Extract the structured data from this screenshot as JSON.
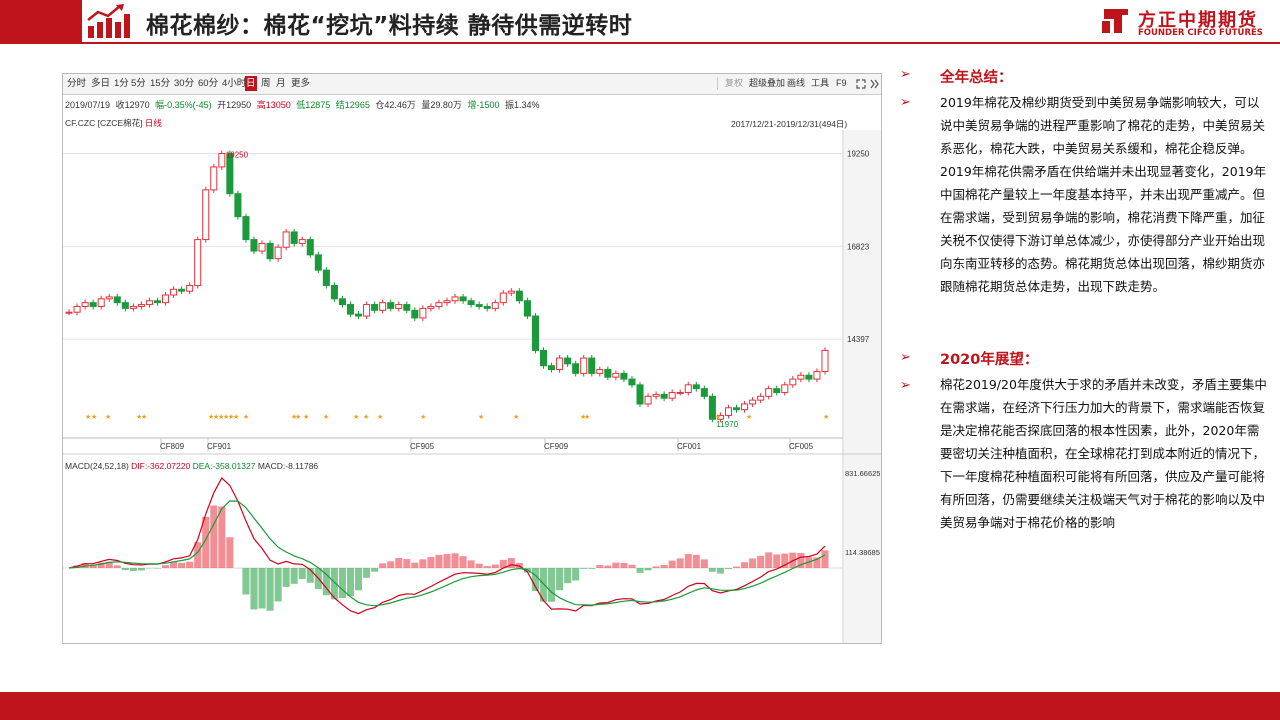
{
  "header": {
    "title": "棉花棉纱：棉花“挖坑”料持续   静待供需逆转时",
    "logo_cn": "方正中期期货",
    "logo_en": "FOUNDER CIFCO FUTURES"
  },
  "toolbar": {
    "periods": [
      "分时",
      "多日",
      "1分",
      "5分",
      "15分",
      "30分",
      "60分",
      "4小时",
      "日",
      "周",
      "月",
      "更多"
    ],
    "active_period": "日",
    "tools": [
      "复权",
      "超级叠加",
      "画线",
      "工具",
      "F9"
    ]
  },
  "quote": {
    "date": "2019/07/19",
    "close": "收12970",
    "change": "幅-0.35%(-45)",
    "open": "开12950",
    "high": "高13050",
    "low": "低12875",
    "settle": "结12965",
    "position": "仓42.46万",
    "volume": "量29.80万",
    "pos_change": "增-1500",
    "amplitude": "振1.34%"
  },
  "chart_legend": {
    "symbol": "CF.CZC [CZCE棉花]",
    "period": "日线",
    "range": "2017/12/21-2019/12/31(494日)"
  },
  "macd": {
    "name": "MACD(24,52,18)",
    "dif": "DIF:-362.07220",
    "dea": "DEA:-358.01327",
    "macd": "MACD:-8.11786"
  },
  "chart_data": {
    "type": "candlestick",
    "y_ticks": [
      "19250",
      "16823",
      "14397"
    ],
    "macd_ticks": [
      "831.66625",
      "114.38685"
    ],
    "x_ticks": [
      "CF809",
      "CF901",
      "CF905",
      "CF909",
      "CF001",
      "CF005"
    ],
    "annotations": [
      {
        "label": "19250",
        "type": "high"
      },
      {
        "label": "11970",
        "type": "low"
      }
    ],
    "close_series": [
      15100,
      15250,
      15350,
      15250,
      15450,
      15500,
      15350,
      15200,
      15250,
      15300,
      15400,
      15350,
      15550,
      15700,
      15650,
      15800,
      17000,
      18300,
      18900,
      19250,
      18200,
      17600,
      17000,
      16700,
      16900,
      16500,
      16800,
      17200,
      16900,
      17000,
      16600,
      16200,
      15800,
      15450,
      15300,
      15050,
      15000,
      15300,
      15150,
      15350,
      15200,
      15300,
      15150,
      14950,
      15200,
      15250,
      15350,
      15400,
      15500,
      15400,
      15300,
      15250,
      15200,
      15350,
      15600,
      15650,
      15400,
      15000,
      14100,
      13700,
      13600,
      13900,
      13750,
      13500,
      13900,
      13500,
      13600,
      13400,
      13500,
      13350,
      13200,
      12700,
      12900,
      12950,
      12850,
      13000,
      13000,
      13200,
      13100,
      12900,
      12300,
      12400,
      12600,
      12550,
      12700,
      12800,
      12900,
      13100,
      13000,
      13200,
      13350,
      13450,
      13350,
      13550,
      14100
    ]
  },
  "summary": {
    "heading1": "全年总结：",
    "para1": "2019年棉花及棉纱期货受到中美贸易争端影响较大，可以说中美贸易争端的进程严重影响了棉花的走势，中美贸易关系恶化，棉花大跌，中美贸易关系缓和，棉花企稳反弹。2019年棉花供需矛盾在供给端并未出现显著变化，2019年中国棉花产量较上一年度基本持平，并未出现严重减产。但在需求端，受到贸易争端的影响，棉花消费下降严重，加征关税不仅使得下游订单总体减少，亦使得部分产业开始出现向东南亚转移的态势。棉花期货总体出现回落，棉纱期货亦跟随棉花期货总体走势，出现下跌走势。",
    "heading2": "2020年展望：",
    "para2": "棉花2019/20年度供大于求的矛盾并未改变，矛盾主要集中在需求端，在经济下行压力加大的背景下，需求端能否恢复是决定棉花能否探底回落的根本性因素，此外，2020年需要密切关注种植面积，在全球棉花打到成本附近的情况下，下一年度棉花种植面积可能将有所回落，供应及产量可能将有所回落，仍需要继续关注极端天气对于棉花的影响以及中美贸易争端对于棉花价格的影响"
  },
  "colors": {
    "brand": "#c0141c",
    "up": "#e8323c",
    "down": "#1a9a3a"
  }
}
